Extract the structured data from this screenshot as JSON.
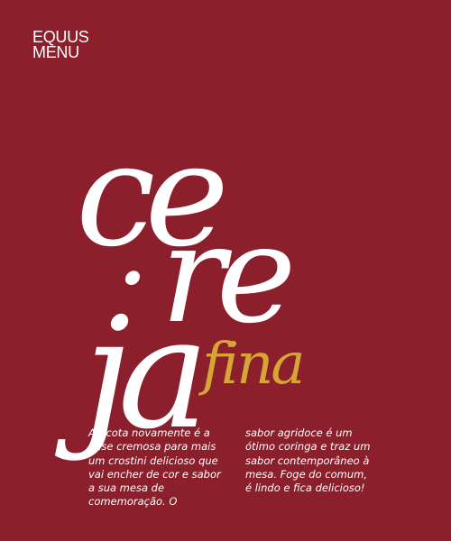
{
  "brand": {
    "line1": "EQUUS",
    "line2": "MENU"
  },
  "headline": {
    "syllable1": "ce",
    "dot": "·",
    "syllable2": "re",
    "syllable3": "ja",
    "subtitle": "fina"
  },
  "body": {
    "column1": "A ricota novamente é a base cremosa para mais um crostini delicioso que vai encher de cor e sabor a sua mesa de comemoração. O",
    "column2": "sabor agridoce é um ótimo coringa e traz um sabor contemporâneo à mesa. Foge do comum, é lindo e fica delicioso!"
  },
  "colors": {
    "background": "#8b1f2b",
    "accent": "#d7a536",
    "text": "#ffffff"
  }
}
